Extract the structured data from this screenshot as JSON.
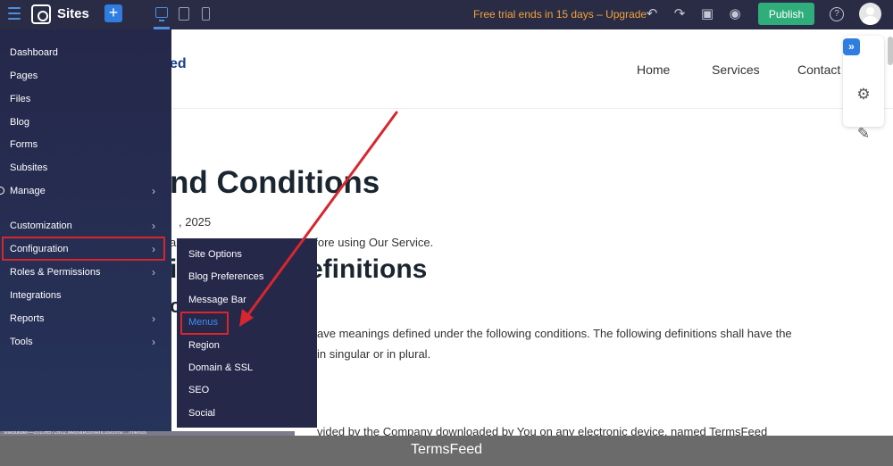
{
  "topbar": {
    "app_name": "Sites",
    "add_label": "+",
    "trial_text": "Free trial ends in 15 days – Upgrade",
    "publish_label": "Publish",
    "help_label": "?",
    "colors": {
      "bar": "#2a2c45",
      "accent": "#2f7de1",
      "trial": "#f0a43a",
      "publish": "#2fae7b"
    }
  },
  "icons": {
    "hamburger": "hamburger-icon",
    "logo": "sites-logo-icon",
    "desktop": "desktop-icon",
    "tablet": "tablet-icon",
    "mobile": "mobile-icon",
    "undo": "undo-icon",
    "redo": "redo-icon",
    "save": "save-icon",
    "preview": "eye-icon",
    "help": "help-icon",
    "avatar": "user-avatar-icon",
    "undo_glyph": "↶",
    "redo_glyph": "↷",
    "save_glyph": "▣",
    "preview_glyph": "◉",
    "chevron_glyph": "›",
    "expand_glyph": "»",
    "design_glyph": "⚙",
    "edit_glyph": "✎"
  },
  "site": {
    "logo_partial": "ed",
    "nav": [
      "Home",
      "Services",
      "Contact"
    ],
    "heading": "nd Conditions",
    "date_partial": ", 2025",
    "para1_partial": "efore using Our Service.",
    "para1_fragment": "a",
    "heading2": "efinitions",
    "heading2_fragment": "i",
    "heading3_fragment": "o",
    "para2_partial": "ave meanings defined under the following conditions. The following definitions shall have the",
    "para3_partial": "in singular or in plural.",
    "para4_partial": "vided by the Company downloaded by You on any electronic device, named TermsFeed"
  },
  "sidebar": {
    "items": [
      {
        "label": "Dashboard",
        "has_chevron": false
      },
      {
        "label": "Pages",
        "has_chevron": false
      },
      {
        "label": "Files",
        "has_chevron": false
      },
      {
        "label": "Blog",
        "has_chevron": false
      },
      {
        "label": "Forms",
        "has_chevron": false
      },
      {
        "label": "Subsites",
        "has_chevron": false
      },
      {
        "label": "Manage",
        "has_chevron": true
      },
      {
        "label": "Customization",
        "has_chevron": true
      },
      {
        "label": "Configuration",
        "has_chevron": true,
        "highlighted": true
      },
      {
        "label": "Roles & Permissions",
        "has_chevron": true
      },
      {
        "label": "Integrations",
        "has_chevron": false
      },
      {
        "label": "Reports",
        "has_chevron": true
      },
      {
        "label": "Tools",
        "has_chevron": true
      }
    ],
    "status_url": "sitebuilder—20106572802.websitecontent.us/cms/…/menus"
  },
  "submenu": {
    "items": [
      {
        "label": "Site Options"
      },
      {
        "label": "Blog Preferences"
      },
      {
        "label": "Message Bar"
      },
      {
        "label": "Menus",
        "active": true
      },
      {
        "label": "Region"
      },
      {
        "label": "Domain & SSL"
      },
      {
        "label": "SEO"
      },
      {
        "label": "Social"
      }
    ]
  },
  "annotation": {
    "color": "#d8262e"
  },
  "caption": "TermsFeed"
}
